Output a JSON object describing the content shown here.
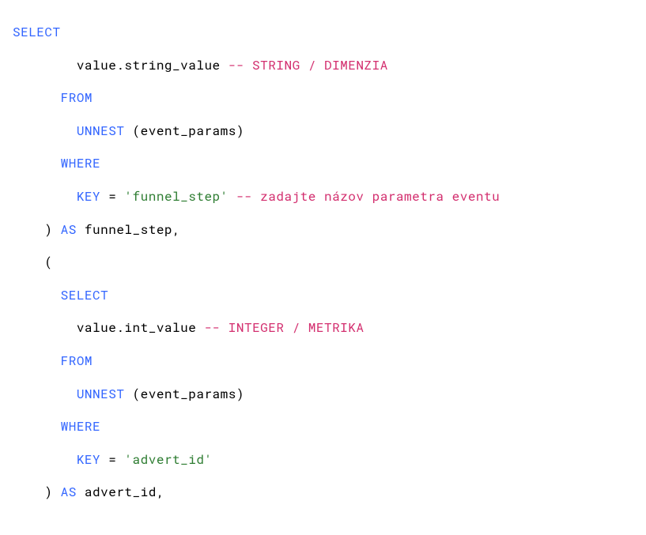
{
  "code": {
    "l1": {
      "select": "SELECT"
    },
    "l2": {
      "expr": "value.string_value",
      "comment": "-- STRING / DIMENZIA"
    },
    "l3": {
      "from": "FROM"
    },
    "l4": {
      "unnest": "UNNEST",
      "args": " (event_params)"
    },
    "l5": {
      "where": "WHERE"
    },
    "l6": {
      "key": "KEY",
      "eq": " = ",
      "str": "'funnel_step'",
      "comment": " -- zadajte názov parametra eventu"
    },
    "l7": {
      "paren": ") ",
      "as": "AS",
      "alias": " funnel_step,"
    },
    "l8": {
      "paren": "("
    },
    "l9": {
      "select": "SELECT"
    },
    "l10": {
      "expr": "value.int_value",
      "comment": "-- INTEGER / METRIKA"
    },
    "l11": {
      "from": "FROM"
    },
    "l12": {
      "unnest": "UNNEST",
      "args": " (event_params)"
    },
    "l13": {
      "where": "WHERE"
    },
    "l14": {
      "key": "KEY",
      "eq": " = ",
      "str": "'advert_id'"
    },
    "l15": {
      "paren": ") ",
      "as": "AS",
      "alias": " advert_id,"
    }
  }
}
